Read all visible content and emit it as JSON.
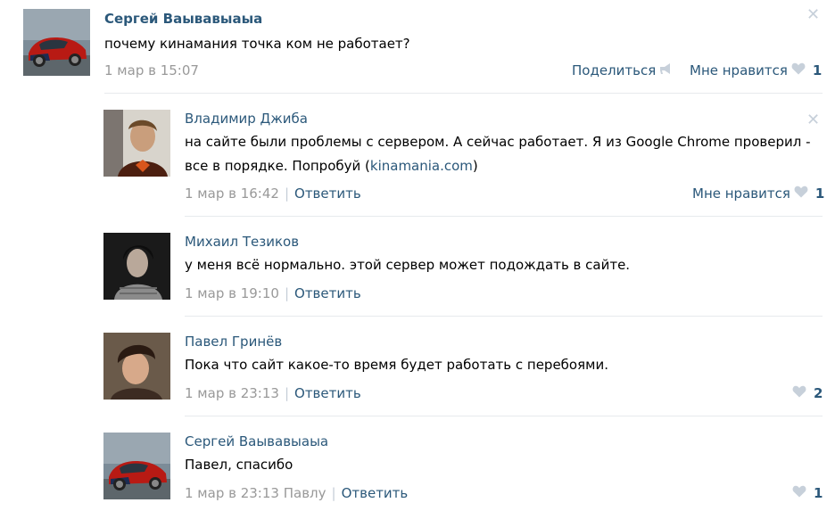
{
  "post": {
    "author": "Сергей Ваывавыаыа",
    "text": "почему кинамания точка ком не работает?",
    "date": "1 мар в 15:07",
    "share_label": "Поделиться",
    "like_label": "Мне нравится",
    "like_count": "1"
  },
  "comments": [
    {
      "author": "Владимир Джиба",
      "text_before": "на сайте были проблемы с сервером. А сейчас работает. Я из Google Chrome проверил - все в порядке. Попробуй (",
      "link": "kinamania.com",
      "text_after": ")",
      "date": "1 мар в 16:42",
      "reply_label": "Ответить",
      "like_label": "Мне нравится",
      "like_count": "1"
    },
    {
      "author": "Михаил Тезиков",
      "text": "у меня всё нормально. этой сервер может подождать в сайте.",
      "date": "1 мар в 19:10",
      "reply_label": "Ответить"
    },
    {
      "author": "Павел Гринёв",
      "text": "Пока что сайт какое-то время будет работать с перебоями.",
      "date": "1 мар в 23:13",
      "reply_label": "Ответить",
      "like_count": "2"
    },
    {
      "author": "Сергей Ваывавыаыа",
      "text": "Павел, спасибо",
      "date": "1 мар в 23:13",
      "reply_to": "Павлу",
      "reply_label": "Ответить",
      "like_count": "1"
    }
  ],
  "icons": {
    "close": "close-icon",
    "heart": "heart-icon",
    "share": "megaphone-icon"
  },
  "colors": {
    "link": "#2b587a",
    "muted": "#999999",
    "heart": "#c7d0da",
    "divider": "#e7eaed"
  }
}
